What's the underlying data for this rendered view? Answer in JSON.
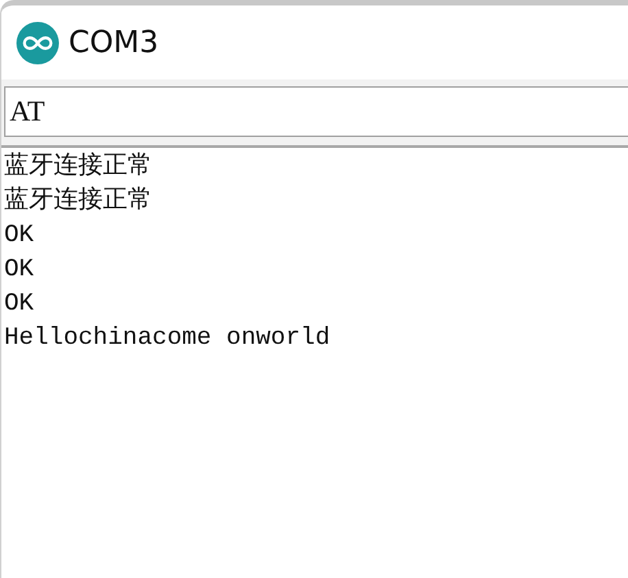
{
  "window": {
    "title": "COM3"
  },
  "send_field": {
    "value": "AT"
  },
  "output_lines": [
    "蓝牙连接正常",
    "蓝牙连接正常",
    "OK",
    "OK",
    "OK",
    "Hellochinacome onworld"
  ]
}
